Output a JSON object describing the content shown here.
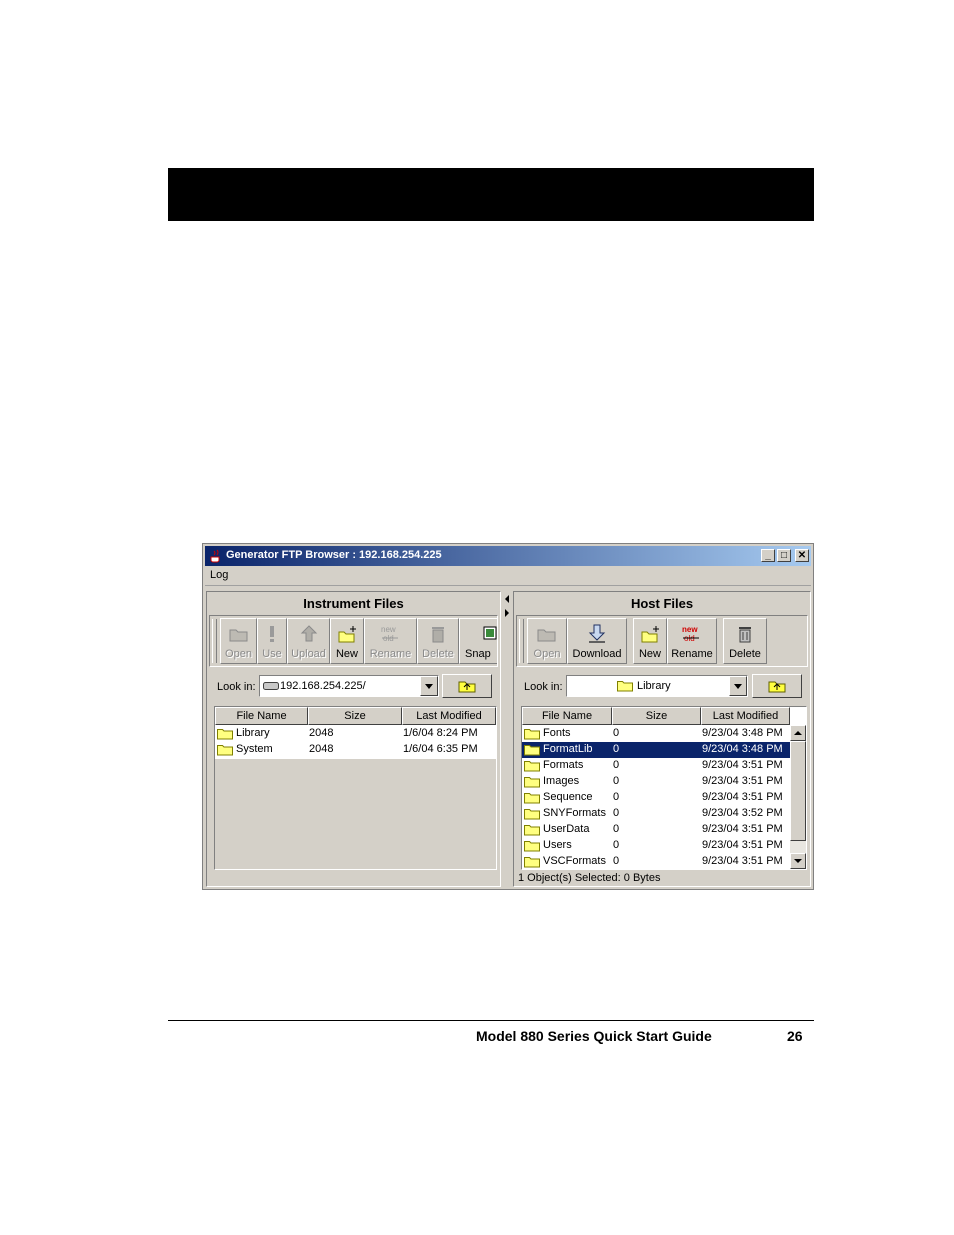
{
  "window": {
    "title": "Generator FTP Browser : 192.168.254.225",
    "menu": [
      "Log"
    ],
    "controls": {
      "minimize": "_",
      "maximize": "□",
      "close": "✕"
    }
  },
  "left": {
    "title": "Instrument Files",
    "toolbar": [
      {
        "label": "Open",
        "icon": "folder-open-icon",
        "enabled": false
      },
      {
        "label": "Use",
        "icon": "exclamation-icon",
        "enabled": false
      },
      {
        "label": "Upload",
        "icon": "upload-icon",
        "enabled": false
      },
      {
        "label": "New",
        "icon": "new-folder-icon",
        "enabled": true
      },
      {
        "label": "Rename",
        "icon": "rename-icon",
        "enabled": false
      },
      {
        "label": "Delete",
        "icon": "trash-icon",
        "enabled": false
      },
      {
        "label": "Snap",
        "icon": "snapshot-icon",
        "enabled": true
      }
    ],
    "look_in_label": "Look in:",
    "look_in_value": "192.168.254.225/",
    "columns": [
      "File Name",
      "Size",
      "Last Modified"
    ],
    "rows": [
      {
        "name": "Library",
        "size": "2048",
        "modified": "1/6/04 8:24 PM"
      },
      {
        "name": "System",
        "size": "2048",
        "modified": "1/6/04 6:35 PM"
      }
    ]
  },
  "right": {
    "title": "Host Files",
    "toolbar": [
      {
        "label": "Open",
        "icon": "folder-open-icon",
        "enabled": false
      },
      {
        "label": "Download",
        "icon": "download-icon",
        "enabled": true
      },
      {
        "label": "New",
        "icon": "new-folder-icon",
        "enabled": true
      },
      {
        "label": "Rename",
        "icon": "rename-icon",
        "enabled": true
      },
      {
        "label": "Delete",
        "icon": "trash-icon",
        "enabled": true
      }
    ],
    "look_in_label": "Look in:",
    "look_in_value": "Library",
    "columns": [
      "File Name",
      "Size",
      "Last Modified"
    ],
    "rows": [
      {
        "name": "Fonts",
        "size": "0",
        "modified": "9/23/04 3:48 PM",
        "selected": false
      },
      {
        "name": "FormatLib",
        "size": "0",
        "modified": "9/23/04 3:48 PM",
        "selected": true
      },
      {
        "name": "Formats",
        "size": "0",
        "modified": "9/23/04 3:51 PM",
        "selected": false
      },
      {
        "name": "Images",
        "size": "0",
        "modified": "9/23/04 3:51 PM",
        "selected": false
      },
      {
        "name": "Sequence",
        "size": "0",
        "modified": "9/23/04 3:51 PM",
        "selected": false
      },
      {
        "name": "SNYFormats",
        "size": "0",
        "modified": "9/23/04 3:52 PM",
        "selected": false
      },
      {
        "name": "UserData",
        "size": "0",
        "modified": "9/23/04 3:51 PM",
        "selected": false
      },
      {
        "name": "Users",
        "size": "0",
        "modified": "9/23/04 3:51 PM",
        "selected": false
      },
      {
        "name": "VSCFormats",
        "size": "0",
        "modified": "9/23/04 3:51 PM",
        "selected": false
      }
    ],
    "status": "1 Object(s) Selected:  0 Bytes"
  },
  "footer": {
    "title": "Model 880 Series Quick Start Guide",
    "page": "26"
  },
  "colors": {
    "titlebar": "#0a246a",
    "selection": "#0a246a",
    "face": "#d4d0c8"
  }
}
